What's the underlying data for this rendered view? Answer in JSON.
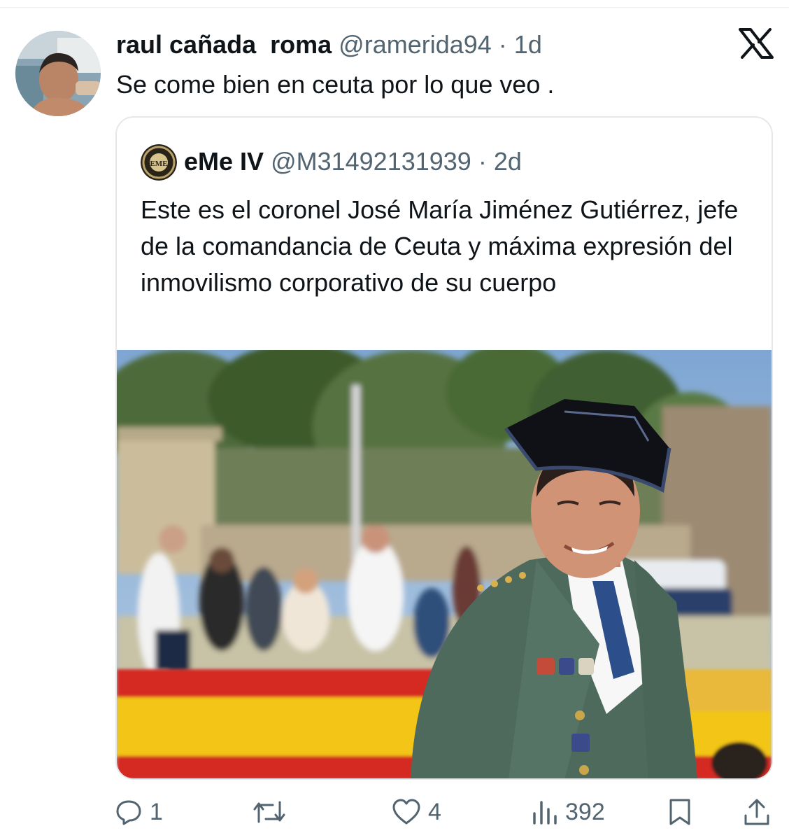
{
  "tweet": {
    "author_name": "raul cañada  roma",
    "handle": "@ramerida94",
    "separator": " · ",
    "time": "1d",
    "text": "Se come bien en ceuta por lo que veo ."
  },
  "quoted_tweet": {
    "author_name": "eMe IV",
    "handle": "@M31492131939",
    "separator": " · ",
    "time": "2d",
    "text": "Este es el coronel José María Jiménez Gutiérrez, jefe de la comandancia de Ceuta y máxima expresión del inmovilismo corporativo de su cuerpo",
    "avatar_text": "EME"
  },
  "actions": {
    "replies": "1",
    "retweets": "",
    "likes": "4",
    "views": "392"
  },
  "icons": [
    "x-logo-icon",
    "reply-icon",
    "retweet-icon",
    "like-icon",
    "views-icon",
    "bookmark-icon",
    "share-icon"
  ],
  "colors": {
    "text": "#0f1419",
    "secondary": "#536471",
    "border": "#e4e8ea"
  }
}
